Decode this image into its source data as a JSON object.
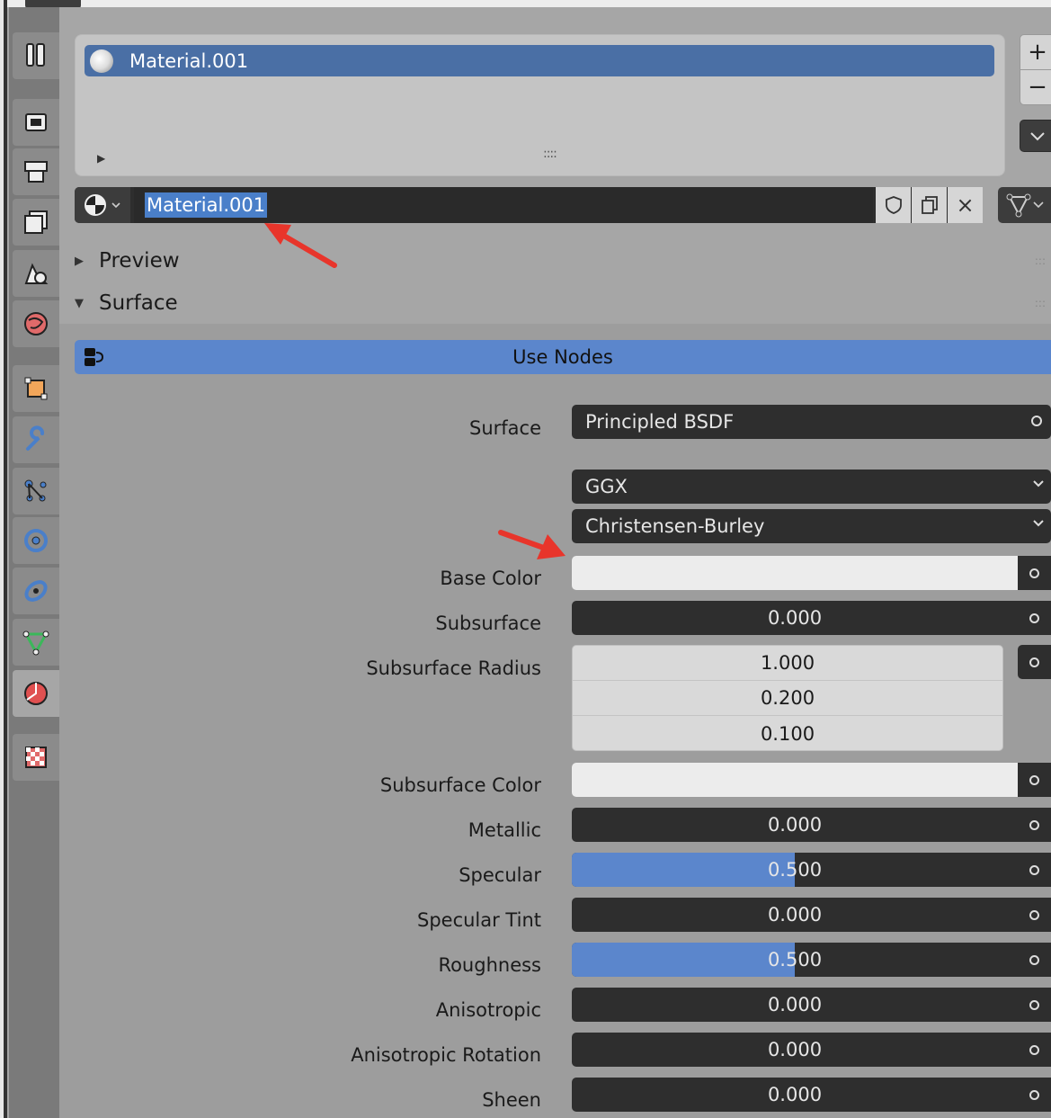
{
  "slots": {
    "selected_label": "Material.001"
  },
  "side_buttons": {
    "add": "+",
    "remove": "−"
  },
  "datablock": {
    "name": "Material.001",
    "close_glyph": "×"
  },
  "panels": {
    "preview": "Preview",
    "surface": "Surface"
  },
  "use_nodes_label": "Use Nodes",
  "properties": {
    "surface_label": "Surface",
    "surface_value": "Principled BSDF",
    "distribution_value": "GGX",
    "subsurface_method_value": "Christensen-Burley",
    "base_color_label": "Base Color",
    "subsurface_label": "Subsurface",
    "subsurface_value": "0.000",
    "subsurface_radius_label": "Subsurface Radius",
    "subsurface_radius_values": [
      "1.000",
      "0.200",
      "0.100"
    ],
    "subsurface_color_label": "Subsurface Color",
    "metallic_label": "Metallic",
    "metallic_value": "0.000",
    "specular_label": "Specular",
    "specular_value": "0.500",
    "specular_fraction": 0.5,
    "specular_tint_label": "Specular Tint",
    "specular_tint_value": "0.000",
    "roughness_label": "Roughness",
    "roughness_value": "0.500",
    "roughness_fraction": 0.5,
    "anisotropic_label": "Anisotropic",
    "anisotropic_value": "0.000",
    "anisotropic_rotation_label": "Anisotropic Rotation",
    "anisotropic_rotation_value": "0.000",
    "sheen_label": "Sheen",
    "sheen_value": "0.000"
  },
  "colors": {
    "accent": "#5b86cc",
    "selection": "#4a6fa5",
    "annotation_arrow": "#e8352b",
    "base_color_swatch": "#ececec",
    "subsurface_color_swatch": "#ececec"
  }
}
